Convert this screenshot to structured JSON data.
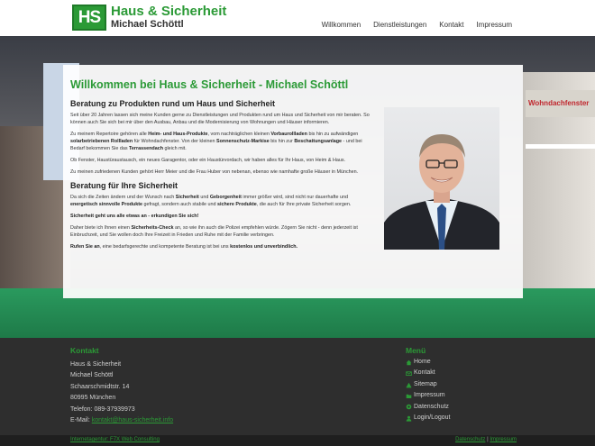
{
  "header": {
    "logo_mark": "HS",
    "title": "Haus & Sicherheit",
    "subtitle": "Michael Schöttl",
    "nav": [
      "Willkommen",
      "Dienstleistungen",
      "Kontakt",
      "Impressum"
    ]
  },
  "hero": {
    "sign_text": "Wohndachfenster"
  },
  "main": {
    "heading": "Willkommen bei Haus & Sicherheit - Michael Schöttl",
    "section1_title": "Beratung zu Produkten rund um Haus und Sicherheit",
    "p1": "Seit über 20 Jahren lassen sich meine Kunden gerne zu Dienstleistungen und Produkten rund um Haus und Sicherheit von mir beraten. So können auch Sie sich bei mir über den Ausbau, Anbau und die Modernisierung von Wohnungen und Häuser informieren.",
    "p2_a": "Zu meinem Repertoire gehören alle ",
    "p2_b1": "Heim- und Haus-Produkte",
    "p2_c": ", vom nachträglichen kleinen ",
    "p2_b2": "Vorbaurollladen",
    "p2_d": " bis hin zu aufwändigen ",
    "p2_b3": "solarbetriebenen Rollladen",
    "p2_e": " für Wohndachfenster. Von der kleinen ",
    "p2_b4": "Sonnenschutz-Markise",
    "p2_f": " bis hin zur ",
    "p2_b5": "Beschattungsanlage",
    "p2_g": " - und bei Bedarf bekommen Sie das ",
    "p2_b6": "Terrassendach",
    "p2_h": " gleich mit.",
    "p3": "Ob Fenster, Haustüraustausch, ein neues Garagentor, oder ein Haustürvordach, wir haben alles für Ihr Haus, von Heim & Haus.",
    "p4": "Zu meinen zufriedenen Kunden gehört Herr Meier und die Frau Huber von nebenan, ebenso wie namhafte große Häuser in München.",
    "section2_title": "Beratung für Ihre Sicherheit",
    "p5_a": "Da sich die Zeiten ändern und der Wunsch nach ",
    "p5_b1": "Sicherheit",
    "p5_c": " und ",
    "p5_b2": "Geborgenheit",
    "p5_d": " immer größer wird, sind nicht nur dauerhafte und ",
    "p5_b3": "energetisch sinnvolle Produkte",
    "p5_e": " gefragt, sondern auch stabile und ",
    "p5_b4": "sichere Produkte",
    "p5_f": ", die auch für Ihre private Sicherheit sorgen.",
    "p6": "Sicherheit geht uns alle etwas an - erkundigen Sie sich!",
    "p7_a": "Daher biete ich Ihnen einen ",
    "p7_b": "Sicherheits-Check",
    "p7_c": " an, so wie ihn auch die Polizei empfehlen würde. Zögern Sie nicht - denn jederzeit ist Einbruchzeit, und Sie wollen doch Ihre Freizeit in Frieden und Ruhe mit der Familie verbringen.",
    "p8_a": "Rufen Sie an",
    "p8_b": ", eine bedarfsgerechte und kompetente Beratung ist bei uns ",
    "p8_c": "kostenlos und unverbindlich."
  },
  "footer": {
    "contact_title": "Kontakt",
    "contact_lines": [
      "Haus & Sicherheit",
      "Michael Schöttl",
      "Schaarschmidtstr. 14",
      "80995 München",
      "Telefon: 089-37939973"
    ],
    "email_label": "E-Mail: ",
    "email": "kontakt@haus-sicherheit.info",
    "menu_title": "Menü",
    "menu": [
      "Home",
      "Kontakt",
      "Sitemap",
      "Impressum",
      "Datenschutz",
      "Login/Logout"
    ]
  },
  "bottombar": {
    "agency": "Internetagentur: F7X Web Consulting",
    "datenschutz": "Datenschutz",
    "separator": "|",
    "impressum": "Impressum"
  },
  "colors": {
    "brand_green": "#2b9a36",
    "footer_bg": "#2e2e2e"
  }
}
